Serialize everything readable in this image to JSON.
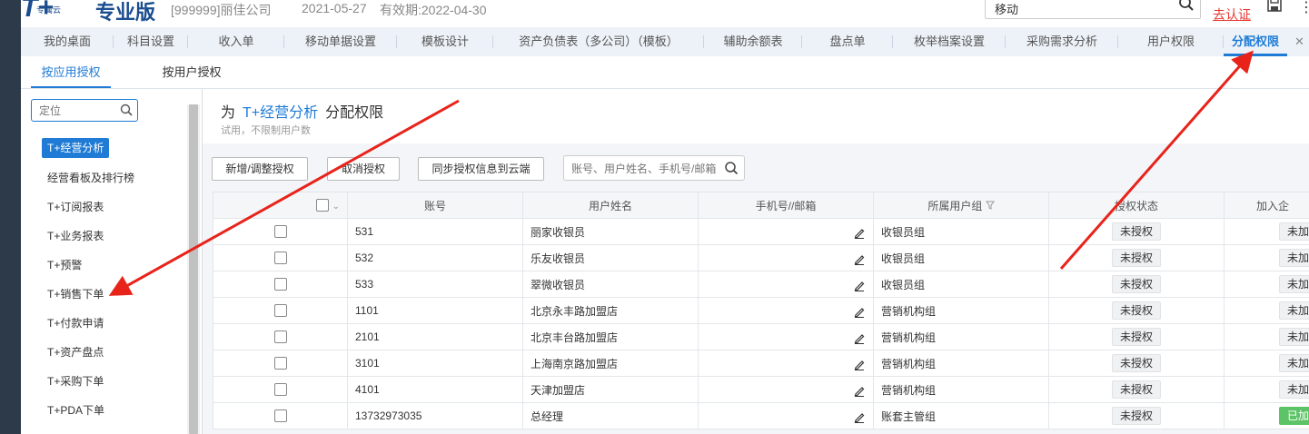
{
  "header": {
    "logo": "T+",
    "logo_sub": "专属云",
    "edition": "专业版",
    "company": "[999999]丽佳公司",
    "date": "2021-05-27",
    "expiry": "有效期:2022-04-30",
    "search_value": "移动",
    "certify": "去认证"
  },
  "tabs": [
    {
      "label": "我的桌面"
    },
    {
      "label": "科目设置"
    },
    {
      "label": "收入单"
    },
    {
      "label": "移动单据设置"
    },
    {
      "label": "模板设计"
    },
    {
      "label": "资产负债表（多公司）（模板）"
    },
    {
      "label": "辅助余额表"
    },
    {
      "label": "盘点单"
    },
    {
      "label": "枚举档案设置"
    },
    {
      "label": "采购需求分析"
    },
    {
      "label": "用户权限"
    },
    {
      "label": "分配权限"
    }
  ],
  "tab_close": "✕",
  "subtabs": [
    {
      "label": "按应用授权"
    },
    {
      "label": "按用户授权"
    }
  ],
  "sidebar": {
    "placeholder": "定位",
    "items": [
      {
        "label": "T+经营分析"
      },
      {
        "label": "经营看板及排行榜"
      },
      {
        "label": "T+订阅报表"
      },
      {
        "label": "T+业务报表"
      },
      {
        "label": "T+预警"
      },
      {
        "label": "T+销售下单"
      },
      {
        "label": "T+付款申请"
      },
      {
        "label": "T+资产盘点"
      },
      {
        "label": "T+采购下单"
      },
      {
        "label": "T+PDA下单"
      }
    ]
  },
  "panel": {
    "title_prefix": "为",
    "title_product": "T+经营分析",
    "title_suffix": "分配权限",
    "subtitle": "试用，不限制用户数"
  },
  "toolbar": {
    "add_label": "新增/调整授权",
    "cancel_label": "取消授权",
    "sync_label": "同步授权信息到云端",
    "search_placeholder": "账号、用户姓名、手机号/邮箱"
  },
  "table": {
    "headers": {
      "account": "账号",
      "name": "用户姓名",
      "phone": "手机号//邮箱",
      "group": "所属用户组",
      "status": "授权状态",
      "join": "加入企"
    },
    "rows": [
      {
        "account": "531",
        "name": "丽家收银员",
        "group": "收银员组",
        "status": "未授权",
        "join": "未加"
      },
      {
        "account": "532",
        "name": "乐友收银员",
        "group": "收银员组",
        "status": "未授权",
        "join": "未加"
      },
      {
        "account": "533",
        "name": "翠微收银员",
        "group": "收银员组",
        "status": "未授权",
        "join": "未加"
      },
      {
        "account": "1101",
        "name": "北京永丰路加盟店",
        "group": "营销机构组",
        "status": "未授权",
        "join": "未加"
      },
      {
        "account": "2101",
        "name": "北京丰台路加盟店",
        "group": "营销机构组",
        "status": "未授权",
        "join": "未加"
      },
      {
        "account": "3101",
        "name": "上海南京路加盟店",
        "group": "营销机构组",
        "status": "未授权",
        "join": "未加"
      },
      {
        "account": "4101",
        "name": "天津加盟店",
        "group": "营销机构组",
        "status": "未授权",
        "join": "未加"
      },
      {
        "account": "13732973035",
        "name": "总经理",
        "group": "账套主管组",
        "status": "未授权",
        "join": "已加"
      }
    ]
  },
  "colors": {
    "accent": "#1f7bd6",
    "arrow": "#e8231a",
    "joined": "#5cc466"
  }
}
